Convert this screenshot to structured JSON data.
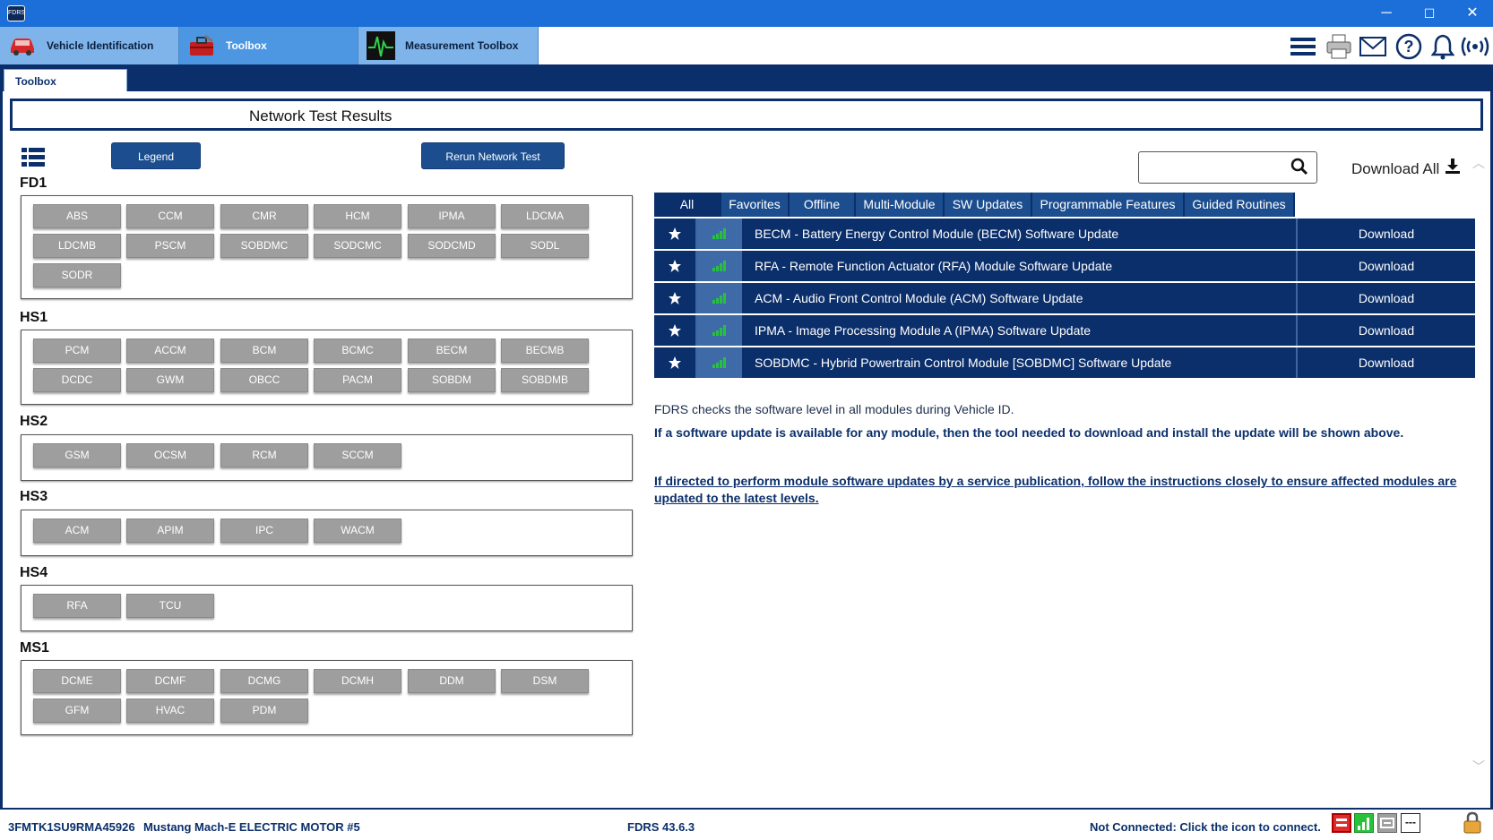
{
  "titlebar": {
    "app_icon_text": "FDRS",
    "minimize": "─",
    "maximize": "☐",
    "close": "✕"
  },
  "main_tabs": [
    {
      "label": "Vehicle Identification",
      "icon": "car-icon"
    },
    {
      "label": "Toolbox",
      "icon": "toolbox-icon"
    },
    {
      "label": "Measurement Toolbox",
      "icon": "oscilloscope-icon"
    }
  ],
  "toolbar_icons": [
    "menu-icon",
    "printer-icon",
    "mail-icon",
    "help-icon",
    "bell-icon",
    "wireless-icon"
  ],
  "sub_tab": "Toolbox",
  "page_title": "Network Test Results",
  "buttons": {
    "legend": "Legend",
    "rerun": "Rerun Network Test"
  },
  "groups": [
    {
      "name": "FD1",
      "modules": [
        "ABS",
        "CCM",
        "CMR",
        "HCM",
        "IPMA",
        "LDCMA",
        "LDCMB",
        "PSCM",
        "SOBDMC",
        "SODCMC",
        "SODCMD",
        "SODL",
        "SODR"
      ]
    },
    {
      "name": "HS1",
      "modules": [
        "PCM",
        "ACCM",
        "BCM",
        "BCMC",
        "BECM",
        "BECMB",
        "DCDC",
        "GWM",
        "OBCC",
        "PACM",
        "SOBDM",
        "SOBDMB"
      ]
    },
    {
      "name": "HS2",
      "modules": [
        "GSM",
        "OCSM",
        "RCM",
        "SCCM"
      ]
    },
    {
      "name": "HS3",
      "modules": [
        "ACM",
        "APIM",
        "IPC",
        "WACM"
      ]
    },
    {
      "name": "HS4",
      "modules": [
        "RFA",
        "TCU"
      ]
    },
    {
      "name": "MS1",
      "modules": [
        "DCME",
        "DCMF",
        "DCMG",
        "DCMH",
        "DDM",
        "DSM",
        "GFM",
        "HVAC",
        "PDM"
      ]
    }
  ],
  "search": {
    "placeholder": ""
  },
  "download_all": "Download All",
  "filter_tabs": [
    "All",
    "Favorites",
    "Offline",
    "Multi-Module",
    "SW Updates",
    "Programmable Features",
    "Guided Routines"
  ],
  "updates": [
    {
      "text": "BECM - Battery Energy Control Module (BECM) Software Update",
      "action": "Download"
    },
    {
      "text": "RFA - Remote Function Actuator (RFA) Module Software Update",
      "action": "Download"
    },
    {
      "text": "ACM - Audio Front Control Module (ACM) Software Update",
      "action": "Download"
    },
    {
      "text": "IPMA - Image Processing Module A (IPMA) Software Update",
      "action": "Download"
    },
    {
      "text": "SOBDMC - Hybrid Powertrain Control Module [SOBDMC] Software Update",
      "action": "Download"
    }
  ],
  "info": {
    "line1": "FDRS checks the software level in all modules during Vehicle ID.",
    "line2": "If a software update is available for any module, then the tool needed to download and install the update will be shown above.",
    "line3": "If directed to perform module software updates by a service publication, follow the instructions closely to ensure affected modules are updated to the latest levels."
  },
  "statusbar": {
    "vin": "3FMTK1SU9RMA45926",
    "vehicle": "Mustang Mach-E ELECTRIC MOTOR #5",
    "version": "FDRS 43.6.3",
    "connection": "Not Connected: Click the icon to connect.",
    "dashes": "---"
  },
  "colors": {
    "navy": "#0b2f6b",
    "tab_blue": "#1c4e8f",
    "titlebar": "#1c6fd8",
    "module_gray": "#9e9e9e",
    "signal_green": "#27c23a"
  }
}
